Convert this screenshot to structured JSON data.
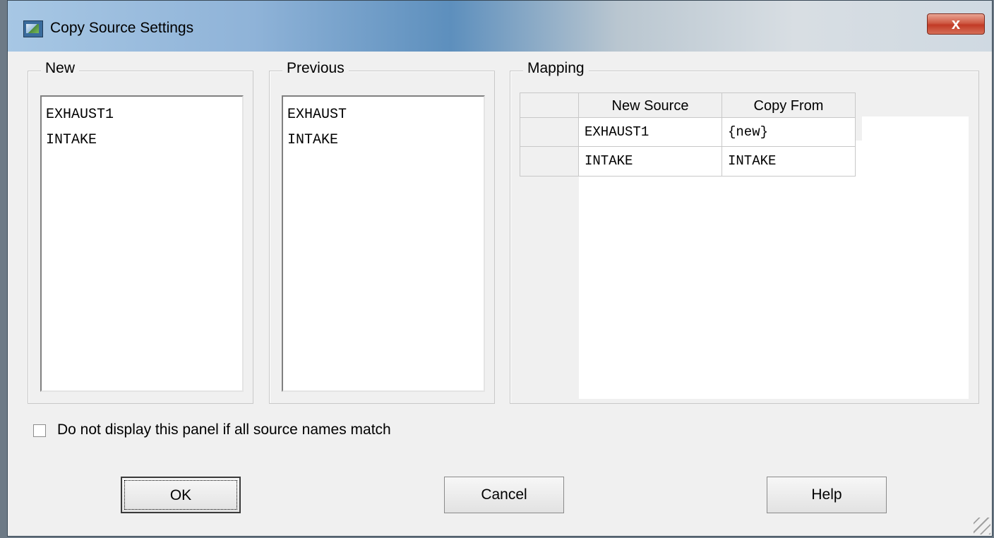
{
  "window": {
    "title": "Copy Source Settings",
    "close_label": "x"
  },
  "groups": {
    "new": {
      "label": "New",
      "items": [
        "EXHAUST1",
        "INTAKE"
      ]
    },
    "previous": {
      "label": "Previous",
      "items": [
        "EXHAUST",
        "INTAKE"
      ]
    },
    "mapping": {
      "label": "Mapping",
      "columns": [
        "New Source",
        "Copy From"
      ],
      "rows": [
        {
          "new_source": "EXHAUST1",
          "copy_from": "{new}"
        },
        {
          "new_source": "INTAKE",
          "copy_from": "INTAKE"
        }
      ]
    }
  },
  "option": {
    "label": "Do not display this panel if all source names match",
    "checked": false
  },
  "buttons": {
    "ok": "OK",
    "cancel": "Cancel",
    "help": "Help"
  }
}
